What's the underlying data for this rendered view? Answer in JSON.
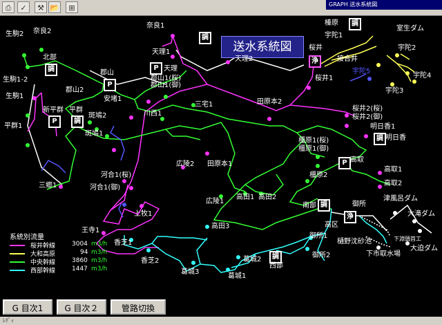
{
  "window": {
    "title": "GRAPH 送水系統図"
  },
  "toolbar": {
    "buttons": [
      {
        "icon": "print-icon"
      },
      {
        "icon": "check-icon"
      },
      {
        "icon": "tool-icon"
      },
      {
        "icon": "folder-open-icon"
      },
      {
        "icon": "new-window-icon"
      }
    ]
  },
  "map": {
    "title": "送水系統図",
    "colors": {
      "sakurai": "#ff33ff",
      "yamato_takahara": "#ffff55",
      "chuo": "#33ff33",
      "seibu": "#33ffff",
      "uda": "#5555ff",
      "boundary": "#ffffff"
    },
    "labels": [
      "生駒2",
      "奈良2",
      "奈良1",
      "北部",
      "生駒1-2",
      "生駒1",
      "平群1",
      "新平群",
      "平群",
      "三郷1",
      "郡山",
      "郡山2",
      "斑鳩2",
      "斑鳩1",
      "安堵1",
      "川西1",
      "郡山1(桜)",
      "郡山1(御)",
      "天理1",
      "天理2",
      "天理",
      "三宅1",
      "広陵2",
      "田原本1",
      "田原本2",
      "高田1",
      "高田2",
      "広陵1",
      "河合1(桜)",
      "河合1(御)",
      "上牧1",
      "王寺1",
      "香芝1",
      "香芝2",
      "高田3",
      "葛城3",
      "葛城2",
      "葛城1",
      "西部",
      "南部",
      "御所",
      "高区",
      "御所1",
      "御所2",
      "樋野沈砂池",
      "下市取水場",
      "下淵頭首工",
      "津風呂ダム",
      "大滝ダム",
      "大迫ダム",
      "桜井",
      "桜井1",
      "桜井2(桜)",
      "桜井2(御)",
      "明日香1",
      "明日香",
      "橿原1(桜)",
      "橿原1(御)",
      "橿原2",
      "高取",
      "高取1",
      "高取2",
      "榛原",
      "宇陀1",
      "室生ダム",
      "接合井",
      "宇陀2",
      "宇陀3",
      "宇陀4",
      "宇陀5"
    ],
    "facility_chars": {
      "cho": "調",
      "jo": "浄",
      "pump": "P"
    }
  },
  "legend": {
    "title": "系統別流量",
    "rows": [
      {
        "name": "桜井幹線",
        "value": "3004",
        "unit": "m3/h"
      },
      {
        "name": "大和高原",
        "value": "94",
        "unit": "m3/h"
      },
      {
        "name": "中央幹線",
        "value": "3860",
        "unit": "m3/h"
      },
      {
        "name": "西部幹線",
        "value": "1447",
        "unit": "m3/h"
      }
    ]
  },
  "buttons": {
    "menu1": "G 目次1",
    "menu2": "G 目次２",
    "switch": "管路切換"
  },
  "status": {
    "text": "ﾚﾃﾞｨ"
  }
}
